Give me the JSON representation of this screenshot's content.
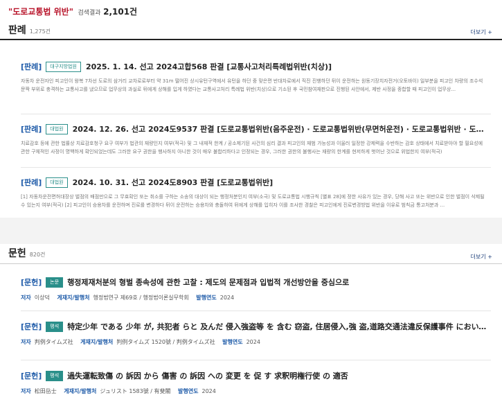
{
  "header": {
    "query": "\"도로교통법 위반\"",
    "label": "검색결과",
    "count": "2,101건"
  },
  "cases": {
    "title": "판례",
    "count": "1,275건",
    "more": "더보기 +",
    "items": [
      {
        "kind": "[판례]",
        "court": "대구지방법원",
        "title": "2025. 1. 14. 선고 2024고합568 판결 [교통사고처리특례법위반(치상)]",
        "summary": "자동차 운전자인 피고인이 왕복 7차선 도로의 삼거리 교차로로부터 약 31m 떨어진 상시유턴구역에서 유턴을 하던 중 맞은편 반대차로에서 직진 진행하던 뒤이 운전하는 원동기장치자전거(오토바이) 일부분을 피고인 차량의 조수석 문짝 부위로 충격하는 교통사고를 냈으므로 업무상의 과실로 뒤에게 상해를 입게 하였다는 교통사고처리 특례법 위반(치상)으로 기소된 후 국민참여재판으로 진행된 사안에서, 제반 사정을 종합할 때 피고인이 업무상..."
      },
      {
        "kind": "[판례]",
        "court": "대법원",
        "title": "2024. 12. 26. 선고 2024도9537 판결 [도로교통법위반(음주운전) · 도로교통법위반(무면허운전) · 도로교통법위반 · 도로교통법위반(사고후미조...",
        "summary": "치료감호 등에 관한 법률상 치료감호청구 요구 여부가 법관의 재량인지 여부(적극) 및 그 내재적 한계 / 공소제기된 사건의 심리 결과 피고인의 재범 가능성과 이울러 일정한 강제력을 수반하는 감호 상태에서 치료받아야 할 필요성에 관한 구체적인 사정이 명백하게 확인되었는데도 그러한 요구 권한을 행사하지 아니한 것이 매우 불합리하다고 인정되는 경우, 그러한 권한의 불행사는 재량의 한계를 현저하게 벗어난 것으로 위법한지 여부(적극)"
      },
      {
        "kind": "[판례]",
        "court": "대법원",
        "title": "2024. 10. 31. 선고 2024도8903 판결 [도로교통법위반]",
        "summary": "[1] 자동차운전면허대장상 벌점의 배점만으로 그 무효확인 또는 취소를 구하는 소송의 대상이 되는 행정처분인지 여부(소극) 및 도로교통법 시행규칙 [별표 28]에 정한 사유가 있는 경우, 당해 사고 또는 위반으로 인한 벌점이 삭제될 수 있는지 여부(적극) [2] 피고인이 승용차를 운전하며 진로를 변경하다 뒤이 운전하는 승용차와 충돌하여 뒤에게 상해를 입히자 이를 조사한 경찰은 피고인에게 진로변경방법 위반을 이유로 범칙금 통고처분과 ..."
      }
    ]
  },
  "literature": {
    "title": "문헌",
    "count": "820건",
    "more": "더보기 +",
    "items": [
      {
        "kind": "[문헌]",
        "badge": "논문",
        "title": "행정제재처분의 형벌 종속성에 관한 고찰 : 제도의 문제점과 입법적 개선방안을 중심으로",
        "author_label": "저자",
        "author": "이상덕",
        "pub_label": "게재지/발행처",
        "pub": "행정법연구 제69호 / 행정법이론실무학회",
        "year_label": "발행연도",
        "year": "2024"
      },
      {
        "kind": "[문헌]",
        "badge": "평석",
        "title": "特定少年 である 少年 が, 共犯者 らと 及んだ 侵入強盗等 を 含む 窃盗, 住居侵入,強 盗,道路交通法違反保護事件 において, 犯情 の 重 さに 加 ...",
        "author_label": "저자",
        "author": "判例タイムズ社",
        "pub_label": "게재지/발행처",
        "pub": "判例タイムズ 1520號 / 判例タイムズ社",
        "year_label": "발행연도",
        "year": "2024"
      },
      {
        "kind": "[문헌]",
        "badge": "평석",
        "title": "過失運転致傷 の 訴因 から 傷害 の 訴因 への 変更 を 促 す 求釈明権行使 の 適否",
        "author_label": "저자",
        "author": "松田岳士",
        "pub_label": "게재지/발행처",
        "pub": "ジュリスト 1583號 / 有斐閣",
        "year_label": "발행연도",
        "year": "2024"
      }
    ]
  }
}
